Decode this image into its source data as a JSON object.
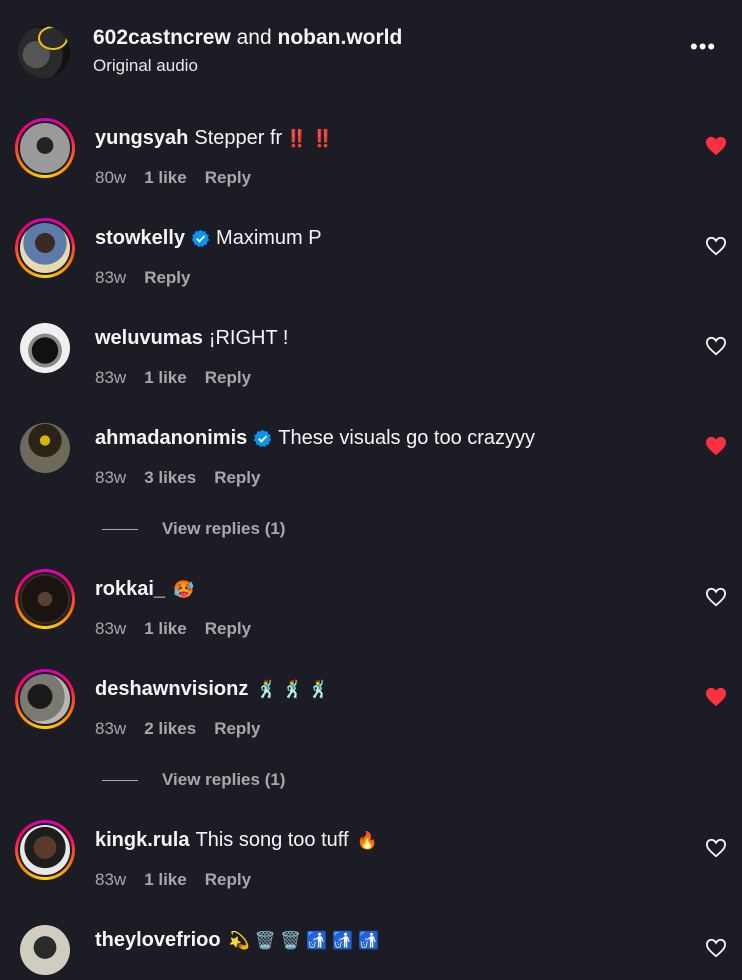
{
  "header": {
    "user1": "602castncrew",
    "joiner": "and",
    "user2": "noban.world",
    "subtitle": "Original audio",
    "more_label": "•••"
  },
  "comments": [
    {
      "username": "yungsyah",
      "verified": false,
      "text": "Stepper fr",
      "emoji": "‼️ ‼️",
      "age": "80w",
      "likes": "1 like",
      "reply": "Reply",
      "liked": true
    },
    {
      "username": "stowkelly",
      "verified": true,
      "text": "Maximum P",
      "emoji": "",
      "age": "83w",
      "likes": "",
      "reply": "Reply",
      "liked": false
    },
    {
      "username": "weluvumas",
      "verified": false,
      "text": "¡RIGHT !",
      "emoji": "",
      "age": "83w",
      "likes": "1 like",
      "reply": "Reply",
      "liked": false
    },
    {
      "username": "ahmadanonimis",
      "verified": true,
      "text": "These visuals go too crazyyy",
      "emoji": "",
      "age": "83w",
      "likes": "3 likes",
      "reply": "Reply",
      "liked": true,
      "view_replies": "View replies (1)"
    },
    {
      "username": "rokkai_",
      "verified": false,
      "text": "",
      "emoji": "🥵",
      "age": "83w",
      "likes": "1 like",
      "reply": "Reply",
      "liked": false
    },
    {
      "username": "deshawnvisionz",
      "verified": false,
      "text": "",
      "emoji": "🕺 🕺 🕺",
      "age": "83w",
      "likes": "2 likes",
      "reply": "Reply",
      "liked": true,
      "view_replies": "View replies (1)"
    },
    {
      "username": "kingk.rula",
      "verified": false,
      "text": "This song too tuff",
      "emoji": "🔥",
      "age": "83w",
      "likes": "1 like",
      "reply": "Reply",
      "liked": false
    },
    {
      "username": "theylovefrioo",
      "verified": false,
      "text": "",
      "emoji": "💫 🗑️ 🗑️ 🚮 🚮 🚮",
      "age": "",
      "likes": "",
      "reply": "",
      "liked": false
    }
  ],
  "colors": {
    "background": "#1c1d24",
    "liked_heart": "#ff3040",
    "muted_text": "#a8a8a8",
    "verified_blue": "#0095f6"
  }
}
